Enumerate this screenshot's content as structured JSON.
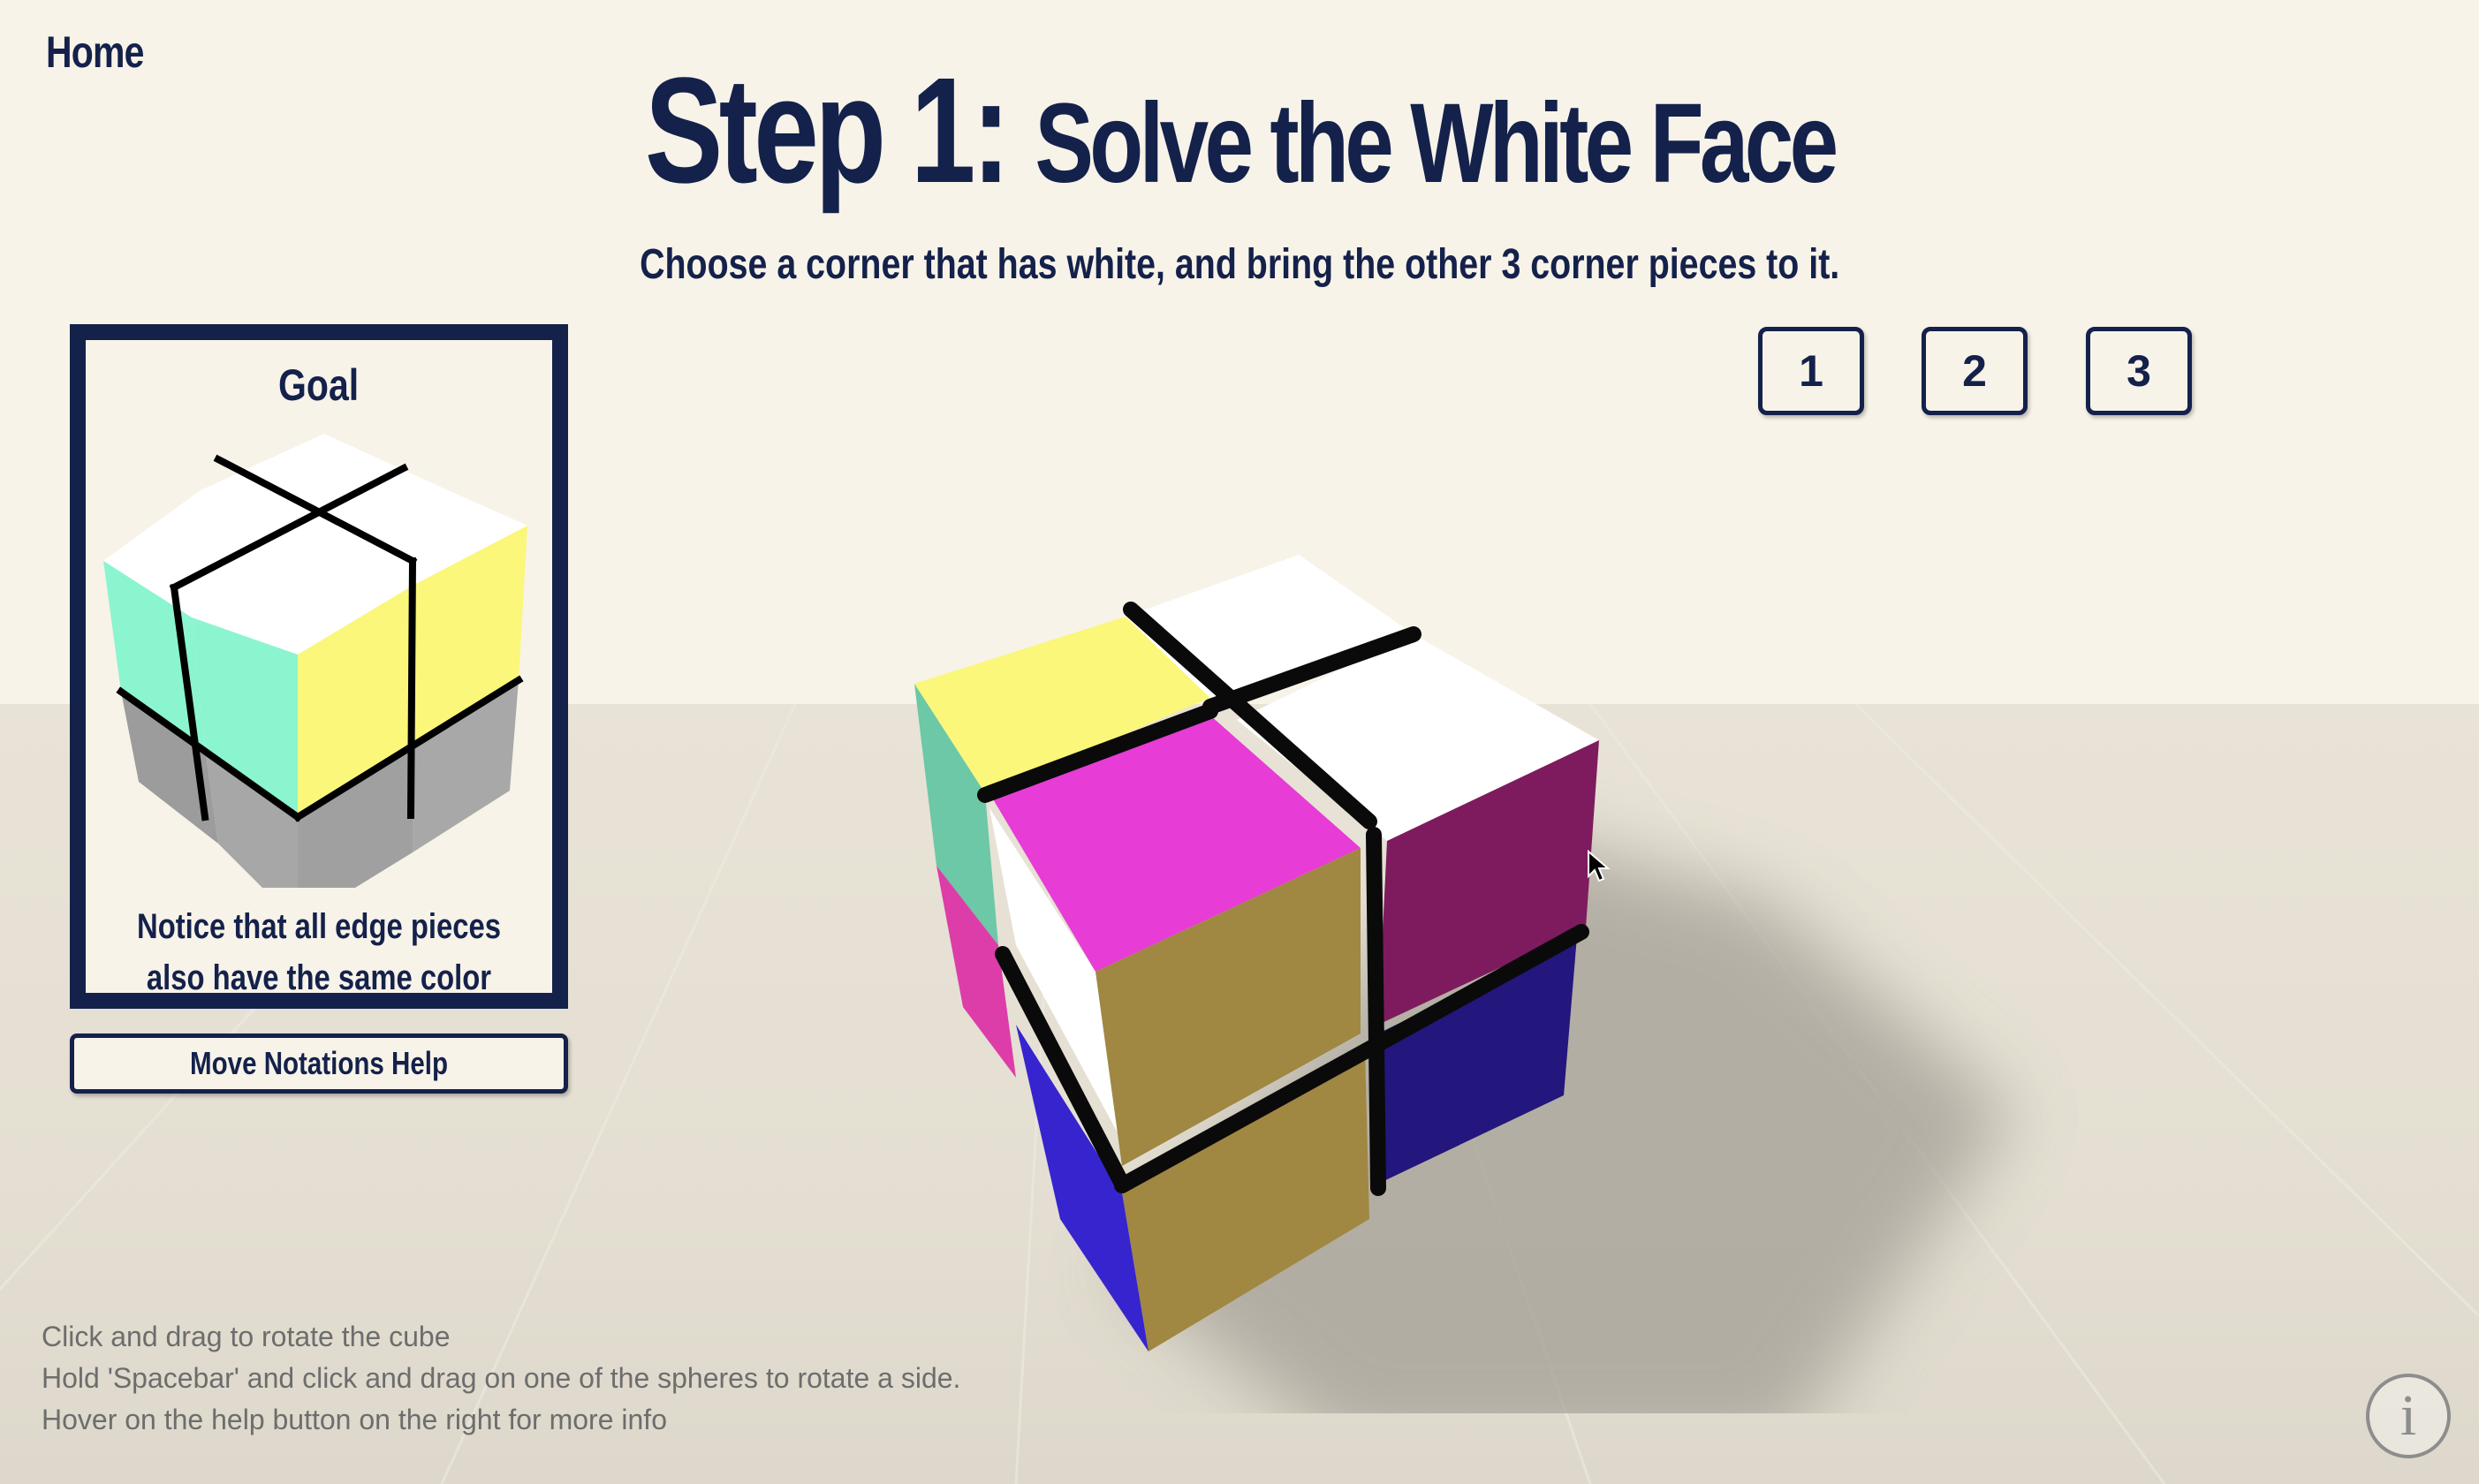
{
  "nav": {
    "home_label": "Home"
  },
  "header": {
    "title_prefix": "Step 1:",
    "title_main": "Solve the White Face",
    "subtitle": "Choose a corner that has white, and bring the other 3 corner pieces to it."
  },
  "step_buttons": [
    {
      "label": "1"
    },
    {
      "label": "2"
    },
    {
      "label": "3"
    }
  ],
  "goal_panel": {
    "title": "Goal",
    "note": "Notice that all edge pieces also have the same color"
  },
  "help_button": {
    "label": "Move Notations Help"
  },
  "instructions": [
    "Click and drag to rotate the cube",
    "Hold 'Spacebar' and click and drag on one of the spheres to rotate a side.",
    "Hover on the help button on the right for more info"
  ],
  "info_button": {
    "icon": "info-icon",
    "glyph": "i"
  },
  "colors": {
    "navy": "#14214b",
    "background": "#f7f3e8",
    "floor": "#e6e1d4",
    "white_sticker": "#ffffff",
    "yellow_sticker": "#faf77a",
    "mint_sticker": "#8bf5cf",
    "gray_sticker": "#a5a5a5",
    "magenta_sticker": "#e73cd5",
    "plum_sticker": "#7e1b5e",
    "gold_sticker": "#a08742",
    "indigo_sticker": "#23167c",
    "blue_sticker": "#3624cf",
    "teal_sticker": "#6cc8a6"
  }
}
